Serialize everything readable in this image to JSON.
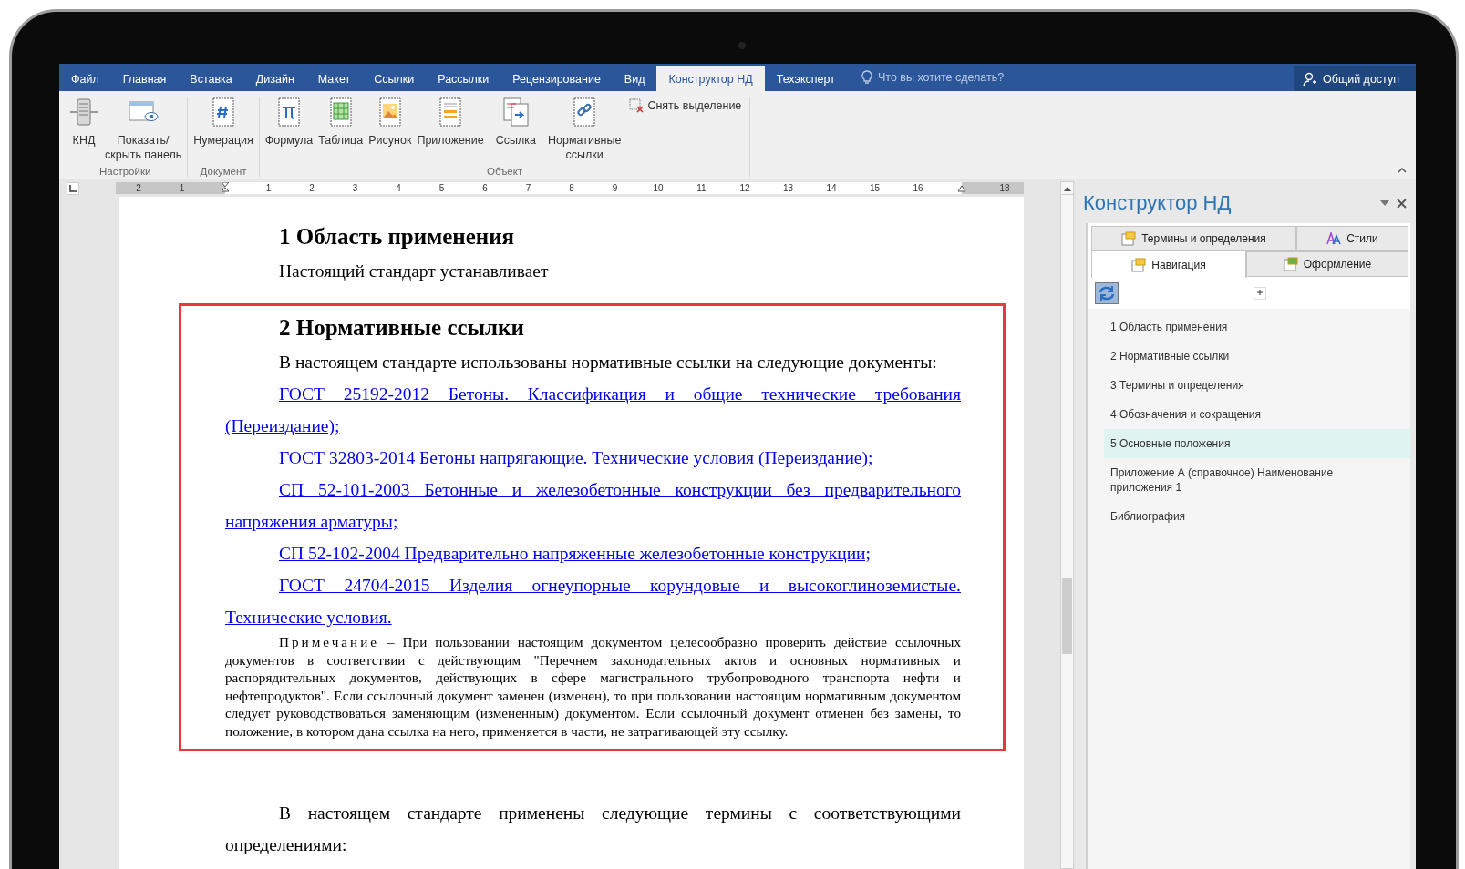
{
  "menu_tabs": [
    {
      "label": "Файл",
      "selected": false
    },
    {
      "label": "Главная",
      "selected": false
    },
    {
      "label": "Вставка",
      "selected": false
    },
    {
      "label": "Дизайн",
      "selected": false
    },
    {
      "label": "Макет",
      "selected": false
    },
    {
      "label": "Ссылки",
      "selected": false
    },
    {
      "label": "Рассылки",
      "selected": false
    },
    {
      "label": "Рецензирование",
      "selected": false
    },
    {
      "label": "Вид",
      "selected": false
    },
    {
      "label": "Конструктор НД",
      "selected": true
    },
    {
      "label": "Техэксперт",
      "selected": false
    }
  ],
  "tell_me": {
    "placeholder": "Что вы хотите сделать?"
  },
  "share_button": "Общий доступ",
  "ribbon_groups": [
    {
      "label": "Настройки",
      "sections": [
        [
          {
            "label": "КНД"
          },
          {
            "label": "Показать/\nскрыть панель"
          }
        ]
      ]
    },
    {
      "label": "Документ",
      "sections": [
        [
          {
            "label": "Нумерация"
          }
        ]
      ]
    },
    {
      "label": "Объект",
      "sections": [
        [
          {
            "label": "Формула"
          },
          {
            "label": "Таблица"
          },
          {
            "label": "Рисунок"
          },
          {
            "label": "Приложение"
          }
        ],
        [
          {
            "label": "Ссылка"
          }
        ],
        [
          {
            "label": "Нормативные\nссылки"
          }
        ]
      ]
    }
  ],
  "small_button": "Снять выделение",
  "ruler": {
    "left_labels": [
      "2",
      "1"
    ],
    "labels": [
      "1",
      "2",
      "3",
      "4",
      "5",
      "6",
      "7",
      "8",
      "9",
      "10",
      "11",
      "12",
      "13",
      "14",
      "15",
      "16"
    ],
    "end_labels": [
      "18"
    ]
  },
  "document": [
    {
      "kind": "heading",
      "text": "1 Область применения"
    },
    {
      "kind": "paragraph",
      "text": "Настоящий стандарт устанавливает"
    },
    {
      "kind": "frame",
      "blocks": [
        {
          "kind": "heading",
          "text": "2 Нормативные ссылки"
        },
        {
          "kind": "paragraph",
          "text": "В настоящем стандарте использованы нормативные ссылки на следующие документы:"
        },
        {
          "kind": "link",
          "text": "ГОСТ 25192-2012 Бетоны. Классификация и общие технические требования (Переиздание);"
        },
        {
          "kind": "link",
          "text": "ГОСТ 32803-2014 Бетоны напрягающие. Технические условия (Переиздание);"
        },
        {
          "kind": "link",
          "text": "СП 52-101-2003 Бетонные и железобетонные конструкции без предварительного напряжения арматуры;"
        },
        {
          "kind": "link",
          "text": "СП 52-102-2004 Предварительно напряженные железобетонные конструкции;"
        },
        {
          "kind": "link",
          "text": "ГОСТ 24704-2015 Изделия огнеупорные корундовые и высокоглиноземистые. Технические условия."
        },
        {
          "kind": "note",
          "label": "Примечание",
          "text": " – При пользовании настоящим документом целесообразно проверить действие ссылочных документов в соответствии с действующим \"Перечнем законодательных актов и основных нормативных и распорядительных документов, действующих в сфере магистрального трубопроводного транспорта нефти и нефтепродуктов\". Если ссылочный документ заменен (изменен), то при пользовании настоящим нормативным документом следует руководствоваться заменяющим (измененным) документом. Если ссылочный документ отменен без замены, то положение, в котором дана ссылка на него, применяется в части, не затрагивающей эту ссылку."
        }
      ]
    },
    {
      "kind": "paragraph",
      "text": "В настоящем стандарте применены следующие термины с соответствующими определениями:"
    }
  ],
  "panel": {
    "title": "Конструктор НД",
    "tab_rows": [
      [
        {
          "label": "Термины и определения",
          "selected": false
        },
        {
          "label": "Стили",
          "selected": false
        }
      ],
      [
        {
          "label": "Навигация",
          "selected": true
        },
        {
          "label": "Оформление",
          "selected": false
        }
      ]
    ],
    "nav_items": [
      {
        "label": "1 Область применения",
        "selected": false
      },
      {
        "label": "2 Нормативные ссылки",
        "selected": false
      },
      {
        "label": "3 Термины и определения",
        "selected": false
      },
      {
        "label": "4 Обозначения и сокращения",
        "selected": false
      },
      {
        "label": "5 Основные положения",
        "selected": true
      },
      {
        "label": "Приложение А (справочное) Наименование приложения 1",
        "selected": false
      },
      {
        "label": "Библиография",
        "selected": false
      }
    ]
  }
}
